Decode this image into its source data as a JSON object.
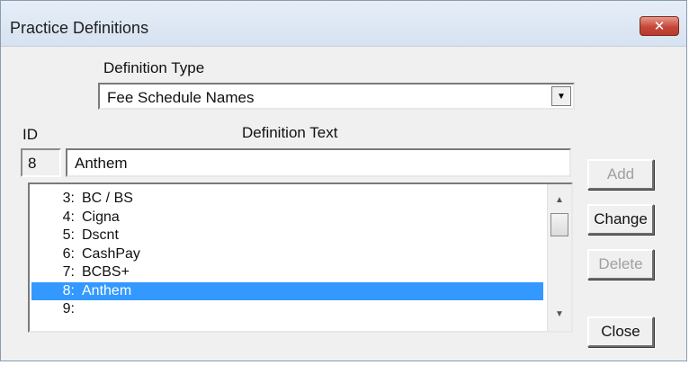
{
  "window": {
    "title": "Practice Definitions",
    "close_glyph": "✕"
  },
  "definition_type": {
    "label": "Definition Type",
    "selected": "Fee Schedule Names"
  },
  "id_field": {
    "label": "ID",
    "value": "8"
  },
  "definition_text": {
    "label": "Definition Text",
    "value": "Anthem"
  },
  "list": {
    "items": [
      {
        "num": "3:",
        "text": "BC / BS"
      },
      {
        "num": "4:",
        "text": "Cigna"
      },
      {
        "num": "5:",
        "text": "Dscnt"
      },
      {
        "num": "6:",
        "text": "CashPay"
      },
      {
        "num": "7:",
        "text": "BCBS+"
      },
      {
        "num": "8:",
        "text": "Anthem"
      },
      {
        "num": "9:",
        "text": ""
      }
    ],
    "selected_index": 5
  },
  "buttons": {
    "add": "Add",
    "change": "Change",
    "delete": "Delete",
    "close": "Close"
  },
  "colors": {
    "selection": "#3399ff",
    "close_red": "#c4483a"
  }
}
